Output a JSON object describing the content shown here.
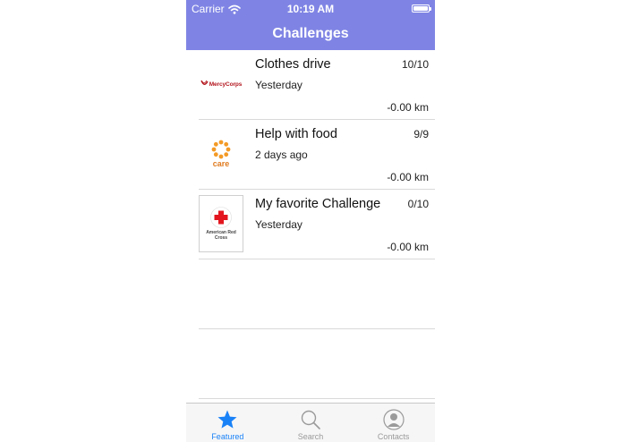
{
  "status_bar": {
    "carrier": "Carrier",
    "time": "10:19 AM"
  },
  "nav": {
    "title": "Challenges"
  },
  "challenges": [
    {
      "title": "Clothes drive",
      "when": "Yesterday",
      "count": "10/10",
      "distance": "-0.00 km",
      "org_logo_text": "MercyCorps"
    },
    {
      "title": "Help with food",
      "when": "2 days ago",
      "count": "9/9",
      "distance": "-0.00 km",
      "org_logo_text": "care"
    },
    {
      "title": "My favorite Challenge",
      "when": "Yesterday",
      "count": "0/10",
      "distance": "-0.00 km",
      "org_logo_text": "American Red Cross"
    }
  ],
  "tabs": [
    {
      "label": "Featured",
      "icon": "star-icon",
      "active": true
    },
    {
      "label": "Search",
      "icon": "magnifier-icon",
      "active": false
    },
    {
      "label": "Contacts",
      "icon": "person-icon",
      "active": false
    }
  ],
  "colors": {
    "header_bg": "#7f84e4",
    "tab_active": "#1a82f7",
    "tab_inactive": "#9a9a9a"
  }
}
